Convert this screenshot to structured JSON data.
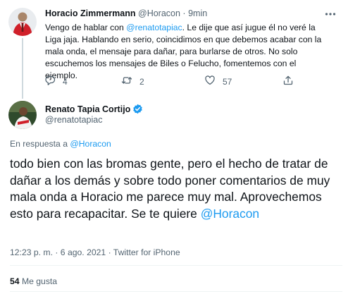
{
  "reply": {
    "author_name": "Horacio Zimmermann",
    "author_handle": "@Horacon",
    "separator": "·",
    "time": "9min",
    "text_before": "Vengo de hablar con ",
    "mention": "@renatotapiac",
    "text_after": ". Le dije que así jugue él no veré la Liga jaja. Hablando en serio, coincidimos en que debemos acabar con la mala onda, el mensaje para dañar, para burlarse de otros. No solo escuchemos los mensajes de Biles o Felucho, fomentemos con el ejemplo.",
    "reply_count": "4",
    "retweet_count": "2",
    "like_count": "57"
  },
  "tweet": {
    "author_name": "Renato Tapia Cortijo",
    "author_handle": "@renatotapiac",
    "replying_to_label": "En respuesta a ",
    "replying_to_handle": "@Horacon",
    "text": "todo bien con las bromas gente, pero el hecho de tratar de dañar a los demás y sobre todo poner comentarios de muy mala onda a Horacio me parece muy mal. Aprovechemos esto para recapacitar. Se te quiere ",
    "mention": "@Horacon",
    "timestamp": "12:23 p. m. · 6 ago. 2021 · Twitter for iPhone",
    "likes_count": "54",
    "likes_label": "Me gusta"
  },
  "icons": {
    "more": "more-horizontal-icon",
    "reply": "reply-icon",
    "retweet": "retweet-icon",
    "like": "heart-icon",
    "share": "share-icon",
    "verified": "verified-badge-icon"
  },
  "colors": {
    "link": "#1d9bf0",
    "muted": "#536471",
    "text": "#0f1419",
    "verified": "#1d9bf0"
  }
}
